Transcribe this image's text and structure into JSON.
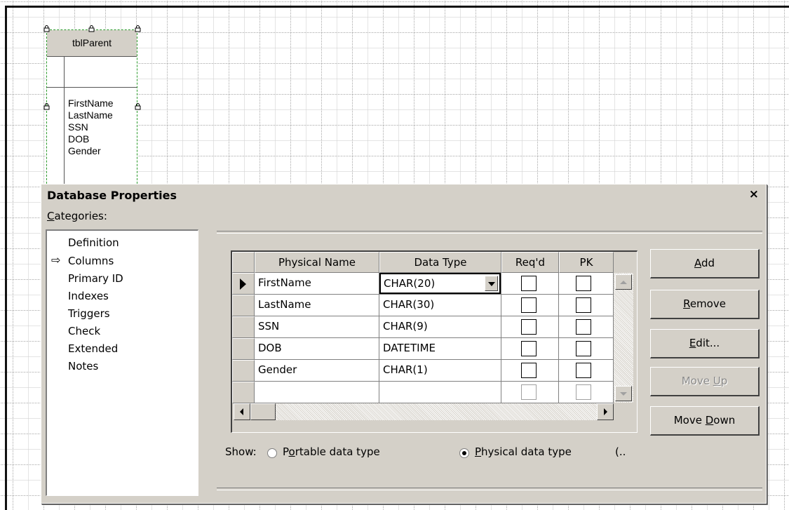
{
  "entity": {
    "name": "tblParent",
    "attributes": [
      "FirstName",
      "LastName",
      "SSN",
      "DOB",
      "Gender"
    ]
  },
  "dialog": {
    "title": "Database Properties",
    "close_glyph": "×",
    "categories_label": "Categories:",
    "categories": [
      "Definition",
      "Columns",
      "Primary ID",
      "Indexes",
      "Triggers",
      "Check",
      "Extended",
      "Notes"
    ],
    "selected_category": "Columns",
    "grid": {
      "headers": [
        "Physical Name",
        "Data Type",
        "Req'd",
        "PK"
      ],
      "rows": [
        {
          "name": "FirstName",
          "type": "CHAR(20)",
          "reqd": false,
          "pk": false,
          "current": true
        },
        {
          "name": "LastName",
          "type": "CHAR(30)",
          "reqd": false,
          "pk": false
        },
        {
          "name": "SSN",
          "type": "CHAR(9)",
          "reqd": false,
          "pk": false
        },
        {
          "name": "DOB",
          "type": "DATETIME",
          "reqd": false,
          "pk": false
        },
        {
          "name": "Gender",
          "type": "CHAR(1)",
          "reqd": false,
          "pk": false
        }
      ]
    },
    "buttons": {
      "add": "Add",
      "remove": "Remove",
      "edit": "Edit...",
      "move_up": "Move Up",
      "move_down": "Move Down"
    },
    "show": {
      "label": "Show:",
      "portable": "Portable data type",
      "physical": "Physical data type",
      "ellipsis": "(..",
      "selected": "physical"
    }
  }
}
